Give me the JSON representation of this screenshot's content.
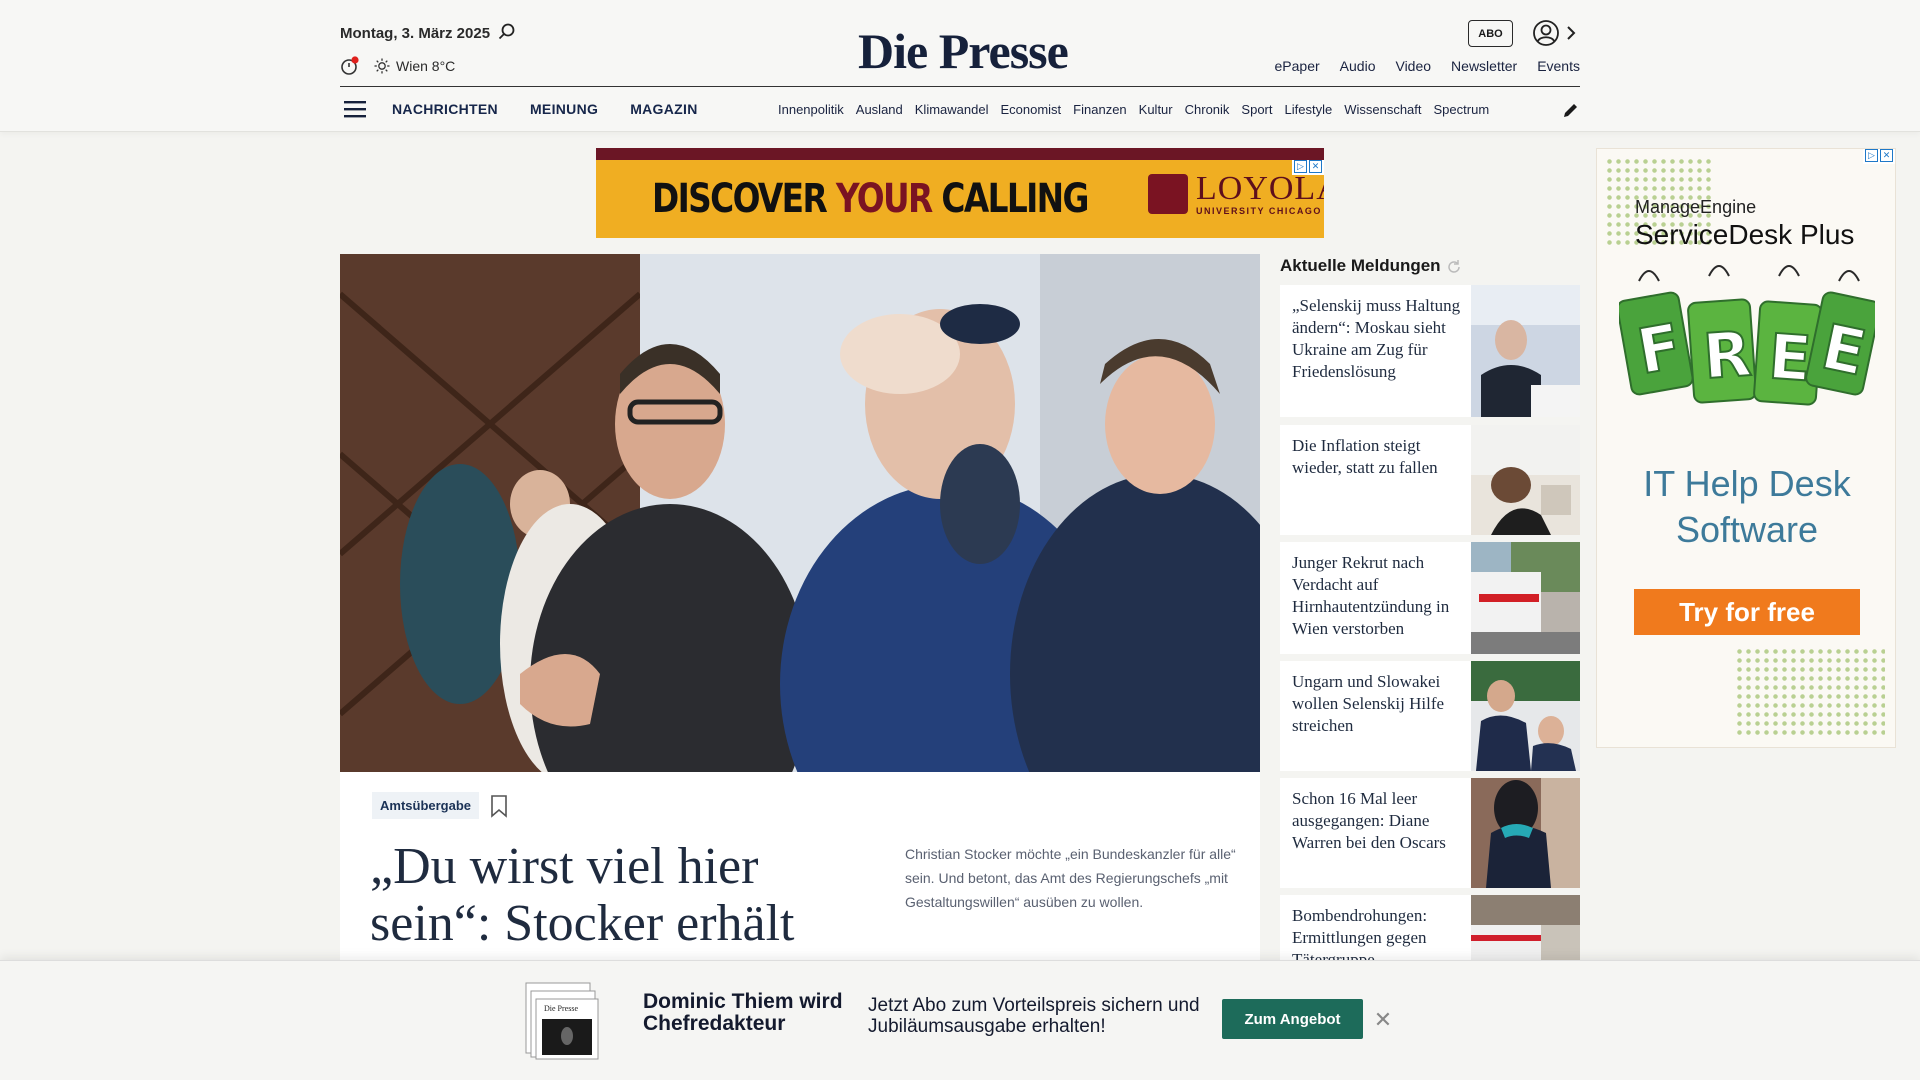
{
  "header": {
    "date": "Montag, 3. März 2025",
    "weather": "Wien 8°C",
    "logo": "Die Presse",
    "abo_label": "ABO",
    "top_links": [
      "ePaper",
      "Audio",
      "Video",
      "Newsletter",
      "Events"
    ],
    "main_nav": [
      "NACHRICHTEN",
      "MEINUNG",
      "MAGAZIN"
    ],
    "sub_nav": [
      "Innenpolitik",
      "Ausland",
      "Klimawandel",
      "Economist",
      "Finanzen",
      "Kultur",
      "Chronik",
      "Sport",
      "Lifestyle",
      "Wissenschaft",
      "Spectrum"
    ],
    "accent_color": "#16213b"
  },
  "top_ad": {
    "slogan_1": "DISCOVER ",
    "slogan_2": "YOUR",
    "slogan_3": " CALLING",
    "brand": "LOYOLA",
    "brand_sub": "UNIVERSITY CHICAGO"
  },
  "hero": {
    "tag": "Amtsübergabe",
    "headline": "„Du wirst viel hier sein“: Stocker erhält",
    "teaser": "Christian Stocker möchte „ein Bundeskanzler für alle“ sein. Und betont, das Amt des Regierungschefs „mit Gestaltungswillen“ ausüben zu wollen."
  },
  "news": {
    "title": "Aktuelle Meldungen",
    "items": [
      {
        "text": "„Selenskij muss Haltung ändern“: Moskau sieht Ukraine am Zug für Friedenslösung"
      },
      {
        "text": "Die Inflation steigt wieder, statt zu fallen"
      },
      {
        "text": "Junger Rekrut nach Verdacht auf Hirnhautentzündung in Wien verstorben"
      },
      {
        "text": "Ungarn und Slowakei wollen Selenskij Hilfe streichen"
      },
      {
        "text": "Schon 16 Mal leer ausgegangen: Diane Warren bei den Oscars"
      },
      {
        "text": "Bombendrohungen: Ermittlungen gegen Tätergruppe"
      }
    ]
  },
  "side_ad": {
    "vendor": "ManageEngine",
    "product": "ServiceDesk Plus",
    "free": "FREE",
    "headline_1": "IT Help Desk",
    "headline_2": "Software",
    "cta": "Try for free"
  },
  "bottom_banner": {
    "name_line": "Dominic Thiem wird Chefredakteur",
    "offer": "Jetzt Abo zum Vorteilspreis sichern und Jubiläumsausgabe erhalten!",
    "button": "Zum Angebot",
    "paper_label": "Die Presse"
  }
}
